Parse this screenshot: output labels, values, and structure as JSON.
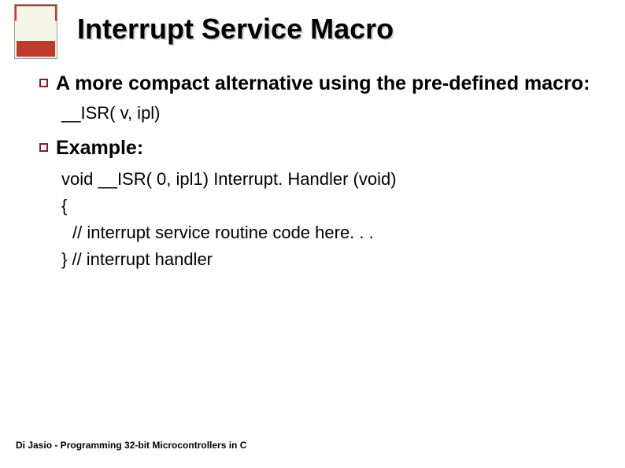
{
  "slide": {
    "title": "Interrupt Service Macro"
  },
  "bullets": {
    "first": {
      "text": "A more compact alternative using the pre-defined macro:",
      "sub": "__ISR( v, ipl)"
    },
    "second": {
      "text": "Example:",
      "code": {
        "line1": "void __ISR( 0, ipl1) Interrupt. Handler (void)",
        "line2": "{",
        "line3": "// interrupt service routine code here. . .",
        "line4": "} // interrupt handler"
      }
    }
  },
  "footer": "Di Jasio - Programming 32-bit Microcontrollers in C"
}
